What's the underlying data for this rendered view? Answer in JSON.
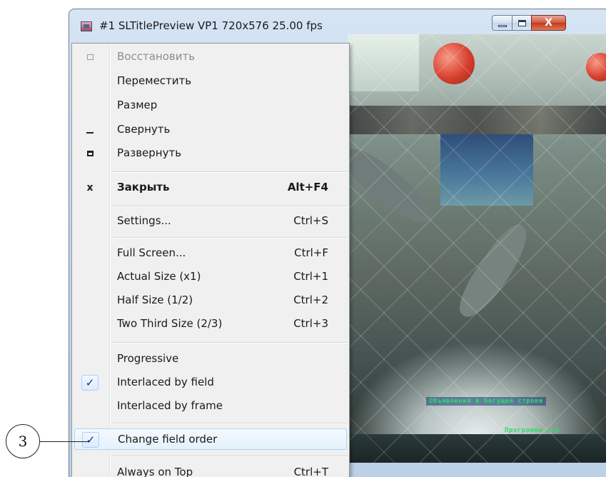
{
  "window": {
    "title": "#1 SLTitlePreview VP1 720x576 25.00 fps",
    "buttons": {
      "close_glyph": "X"
    }
  },
  "video": {
    "ticker_1": "Объявления в бегущей строке",
    "ticker_2": "Программа игр"
  },
  "menu": {
    "items": [
      {
        "label": "Восстановить",
        "shortcut": "",
        "icon": "restore-icon",
        "disabled": true
      },
      {
        "label": "Переместить",
        "shortcut": ""
      },
      {
        "label": "Размер",
        "shortcut": ""
      },
      {
        "label": "Свернуть",
        "shortcut": "",
        "icon": "minimize-icon"
      },
      {
        "label": "Развернуть",
        "shortcut": "",
        "icon": "maximize-icon"
      },
      {
        "label": "Закрыть",
        "shortcut": "Alt+F4",
        "icon": "close-icon",
        "icon_glyph": "x",
        "bold": true
      },
      {
        "label": "Settings...",
        "shortcut": "Ctrl+S"
      },
      {
        "label": "Full Screen...",
        "shortcut": "Ctrl+F"
      },
      {
        "label": "Actual Size (x1)",
        "shortcut": "Ctrl+1"
      },
      {
        "label": "Half Size (1/2)",
        "shortcut": "Ctrl+2"
      },
      {
        "label": "Two Third Size (2/3)",
        "shortcut": "Ctrl+3"
      },
      {
        "label": "Progressive",
        "shortcut": ""
      },
      {
        "label": "Interlaced by field",
        "shortcut": "",
        "checked": true,
        "check_glyph": "✓"
      },
      {
        "label": "Interlaced by frame",
        "shortcut": ""
      },
      {
        "label": "Change field order",
        "shortcut": "",
        "checked": true,
        "check_glyph": "✓",
        "highlighted": true
      },
      {
        "label": "Always on Top",
        "shortcut": "Ctrl+T"
      }
    ]
  },
  "callout": {
    "number": "3"
  },
  "colors": {
    "menu_bg": "#f0f0f0",
    "highlight_border": "#a8d8f8",
    "check_color": "#0b2a88",
    "ticker_green": "#2fdc6a",
    "close_button": "#c23a1f"
  }
}
